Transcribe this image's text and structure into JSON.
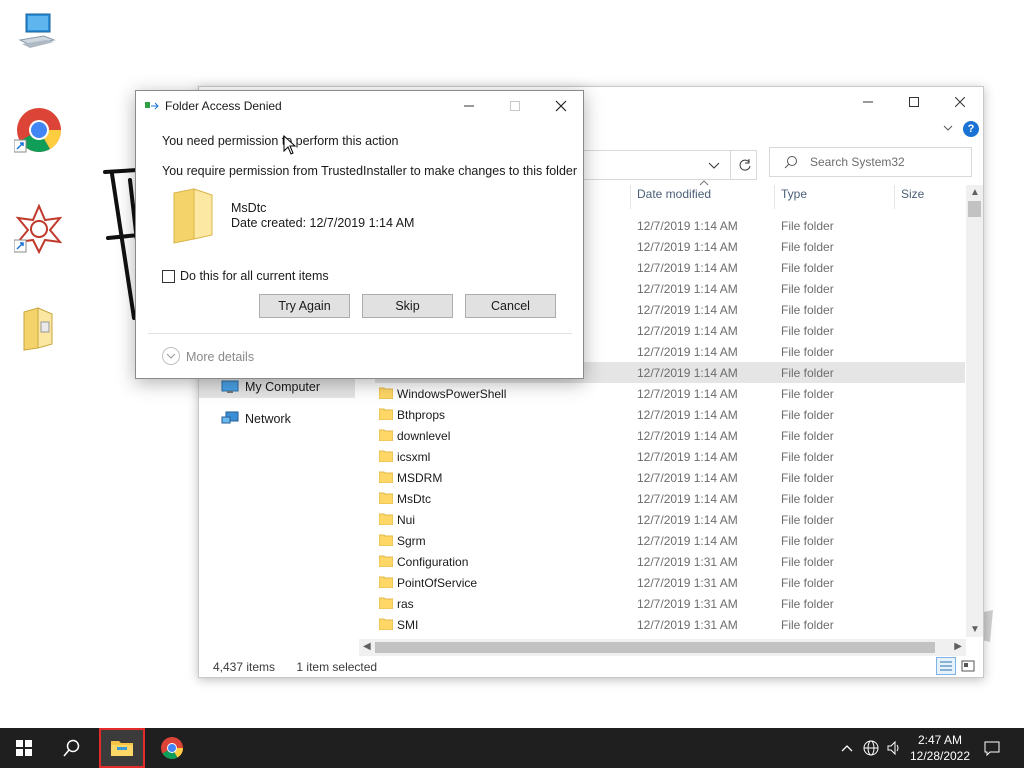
{
  "desktop": {
    "icons": [
      {
        "name": "This PC"
      },
      {
        "name": "Google Chrome"
      },
      {
        "name": "Application shortcut"
      },
      {
        "name": "Folder"
      }
    ]
  },
  "explorer": {
    "search_placeholder": "Search System32",
    "columns": {
      "date": "Date modified",
      "type": "Type",
      "size": "Size"
    },
    "nav": [
      {
        "label": "My Computer"
      },
      {
        "label": "Network"
      }
    ],
    "rows": [
      {
        "name": "",
        "date": "12/7/2019 1:14 AM",
        "type": "File folder"
      },
      {
        "name": "",
        "date": "12/7/2019 1:14 AM",
        "type": "File folder"
      },
      {
        "name": "",
        "date": "12/7/2019 1:14 AM",
        "type": "File folder"
      },
      {
        "name": "",
        "date": "12/7/2019 1:14 AM",
        "type": "File folder"
      },
      {
        "name": "",
        "date": "12/7/2019 1:14 AM",
        "type": "File folder"
      },
      {
        "name": "",
        "date": "12/7/2019 1:14 AM",
        "type": "File folder"
      },
      {
        "name": "",
        "date": "12/7/2019 1:14 AM",
        "type": "File folder"
      },
      {
        "name": "",
        "date": "12/7/2019 1:14 AM",
        "type": "File folder",
        "selected": true
      },
      {
        "name": "WindowsPowerShell",
        "date": "12/7/2019 1:14 AM",
        "type": "File folder"
      },
      {
        "name": "Bthprops",
        "date": "12/7/2019 1:14 AM",
        "type": "File folder"
      },
      {
        "name": "downlevel",
        "date": "12/7/2019 1:14 AM",
        "type": "File folder"
      },
      {
        "name": "icsxml",
        "date": "12/7/2019 1:14 AM",
        "type": "File folder"
      },
      {
        "name": "MSDRM",
        "date": "12/7/2019 1:14 AM",
        "type": "File folder"
      },
      {
        "name": "MsDtc",
        "date": "12/7/2019 1:14 AM",
        "type": "File folder"
      },
      {
        "name": "Nui",
        "date": "12/7/2019 1:14 AM",
        "type": "File folder"
      },
      {
        "name": "Sgrm",
        "date": "12/7/2019 1:14 AM",
        "type": "File folder"
      },
      {
        "name": "Configuration",
        "date": "12/7/2019 1:31 AM",
        "type": "File folder"
      },
      {
        "name": "PointOfService",
        "date": "12/7/2019 1:31 AM",
        "type": "File folder"
      },
      {
        "name": "ras",
        "date": "12/7/2019 1:31 AM",
        "type": "File folder"
      },
      {
        "name": "SMI",
        "date": "12/7/2019 1:31 AM",
        "type": "File folder"
      }
    ],
    "status": {
      "items": "4,437 items",
      "selected": "1 item selected"
    }
  },
  "dialog": {
    "title": "Folder Access Denied",
    "line1": "You need permission to perform this action",
    "line2": "You require permission from TrustedInstaller to make changes to this folder",
    "folder_name": "MsDtc",
    "folder_date": "Date created: 12/7/2019 1:14 AM",
    "checkbox_label": "Do this for all current items",
    "buttons": {
      "try_again": "Try Again",
      "skip": "Skip",
      "cancel": "Cancel"
    },
    "more_details": "More details"
  },
  "taskbar": {
    "time": "2:47 AM",
    "date": "12/28/2022"
  },
  "colors": {
    "folder_yellow": "#ffd766",
    "taskbar": "#1f1f1f",
    "selection": "#e5e5e5",
    "accent": "#1a73d4"
  }
}
